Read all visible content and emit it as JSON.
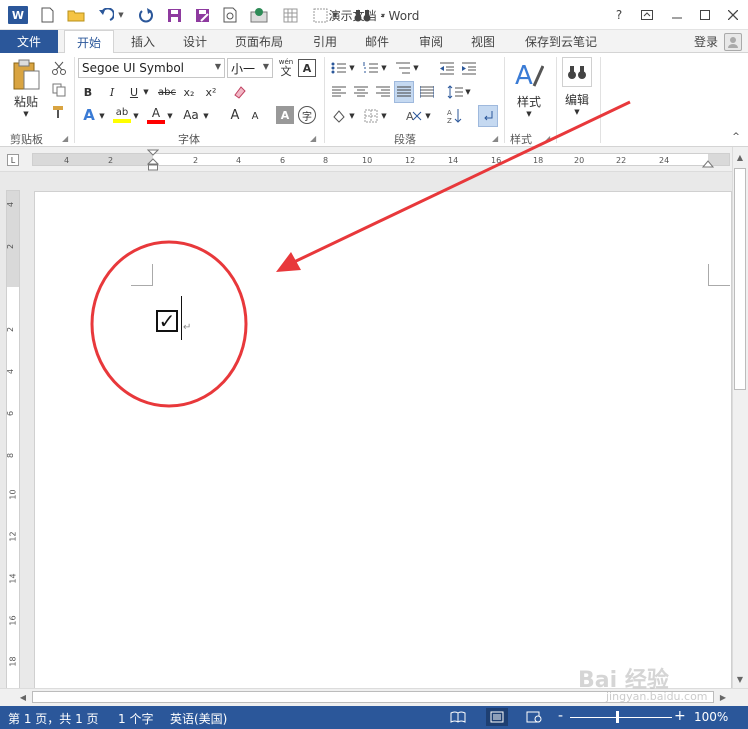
{
  "titlebar": {
    "app_title": "演示文档 - Word",
    "help": "?",
    "logo": "W"
  },
  "tabs": {
    "file": "文件",
    "items": [
      "开始",
      "插入",
      "设计",
      "页面布局",
      "引用",
      "邮件",
      "审阅",
      "视图",
      "保存到云笔记"
    ],
    "active": "开始",
    "login": "登录"
  },
  "ribbon": {
    "clipboard": {
      "label": "剪贴板",
      "paste": "粘贴"
    },
    "font": {
      "label": "字体",
      "font_name": "Segoe UI Symbol",
      "font_size": "小一",
      "pinyin_top": "wén",
      "pinyin_bottom": "文",
      "border_char": "A",
      "bold": "B",
      "italic": "I",
      "underline": "U",
      "strike": "abc",
      "subscript": "x₂",
      "superscript": "x²",
      "text_effect": "A",
      "highlight": "ab",
      "font_color": "A",
      "change_case": "Aa",
      "grow": "A",
      "shrink": "A",
      "char_shade": "A",
      "enclose": "字"
    },
    "paragraph": {
      "label": "段落"
    },
    "styles": {
      "label": "样式",
      "button": "样式"
    },
    "editing": {
      "button": "编辑"
    }
  },
  "ruler": {
    "h_ticks": [
      "4",
      "2",
      "2",
      "4",
      "6",
      "8",
      "10",
      "12",
      "14",
      "16",
      "18",
      "20",
      "22",
      "24"
    ],
    "v_ticks": [
      "4",
      "2",
      "2",
      "4",
      "6",
      "8",
      "10",
      "12",
      "14",
      "16",
      "18"
    ]
  },
  "document": {
    "checkbox": "✓",
    "paragraph_mark": "↵"
  },
  "statusbar": {
    "page": "第 1 页，共 1 页",
    "words": "1 个字",
    "language": "英语(美国)",
    "zoom": "100%",
    "zoom_minus": "-",
    "zoom_plus": "+"
  },
  "annotation": {
    "color": "#e8383b"
  },
  "watermark": {
    "text": "Bai 经验",
    "url": "jingyan.baidu.com"
  },
  "colors": {
    "accent": "#2b579a",
    "highlight_yellow": "#ffff00",
    "font_red": "#ff0000"
  }
}
